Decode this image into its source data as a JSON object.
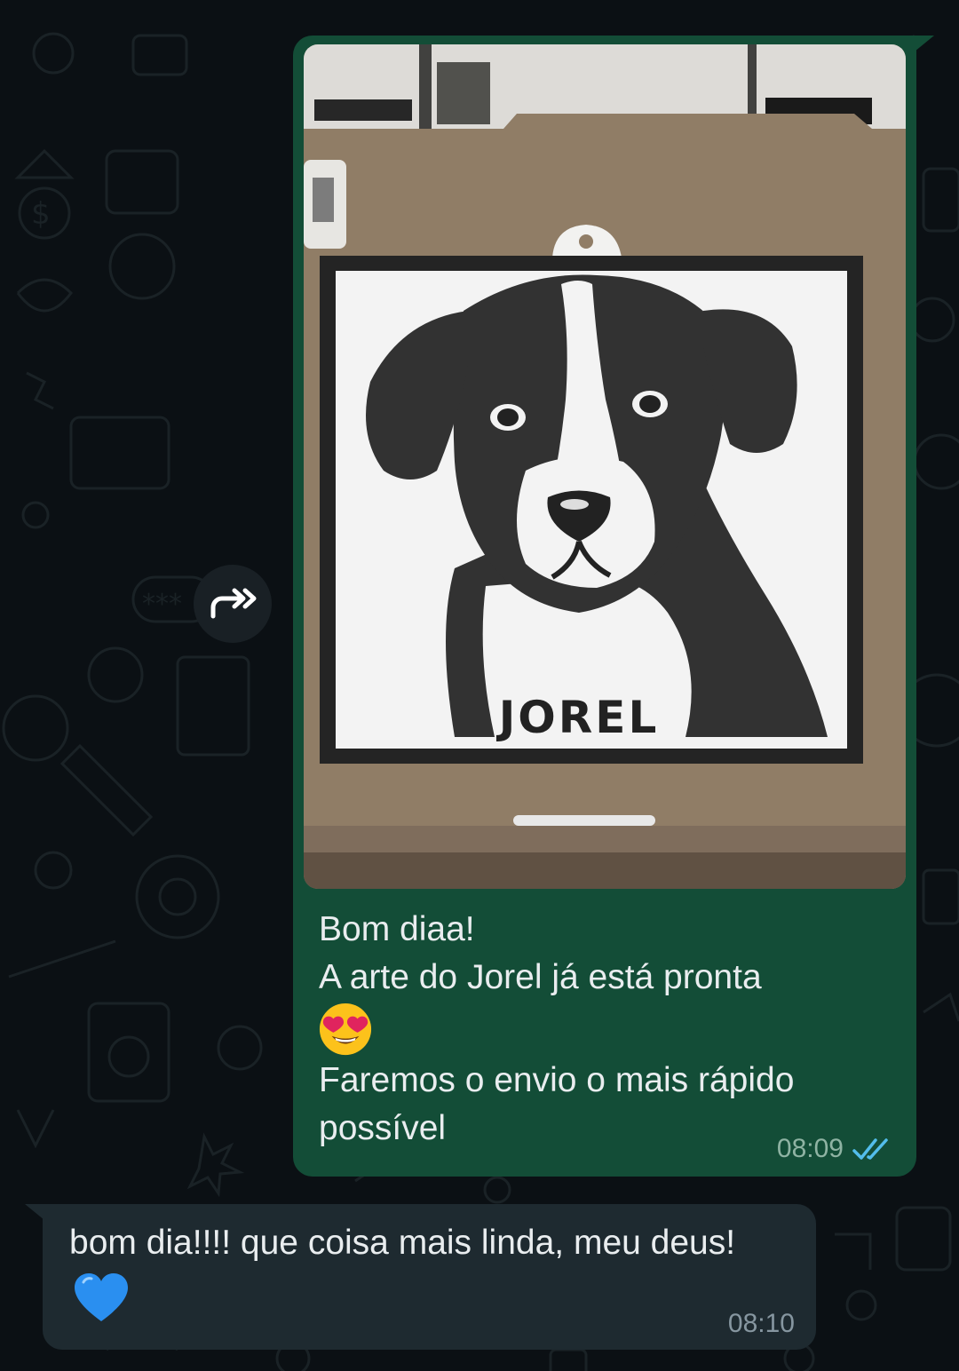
{
  "chat": {
    "outgoing": {
      "photo": {
        "name_on_art": "JOREL"
      },
      "lines": [
        "Bom diaa!",
        "A arte do Jorel já está pronta",
        "Faremos o envio o mais rápido",
        "possível"
      ],
      "emoji": "heart-eyes-emoji",
      "time": "08:09",
      "status_icon": "double-check-read-icon",
      "status_color": "#53bdeb"
    },
    "incoming": {
      "text": "bom dia!!!! que coisa mais linda, meu deus!",
      "emoji": "blue-heart-emoji",
      "time": "08:10"
    },
    "forward_icon": "forward-arrow-icon"
  },
  "colors": {
    "background": "#0b1014",
    "outgoing_bubble": "#134d37",
    "incoming_bubble": "#1e2a30",
    "text": "#e9edef"
  }
}
